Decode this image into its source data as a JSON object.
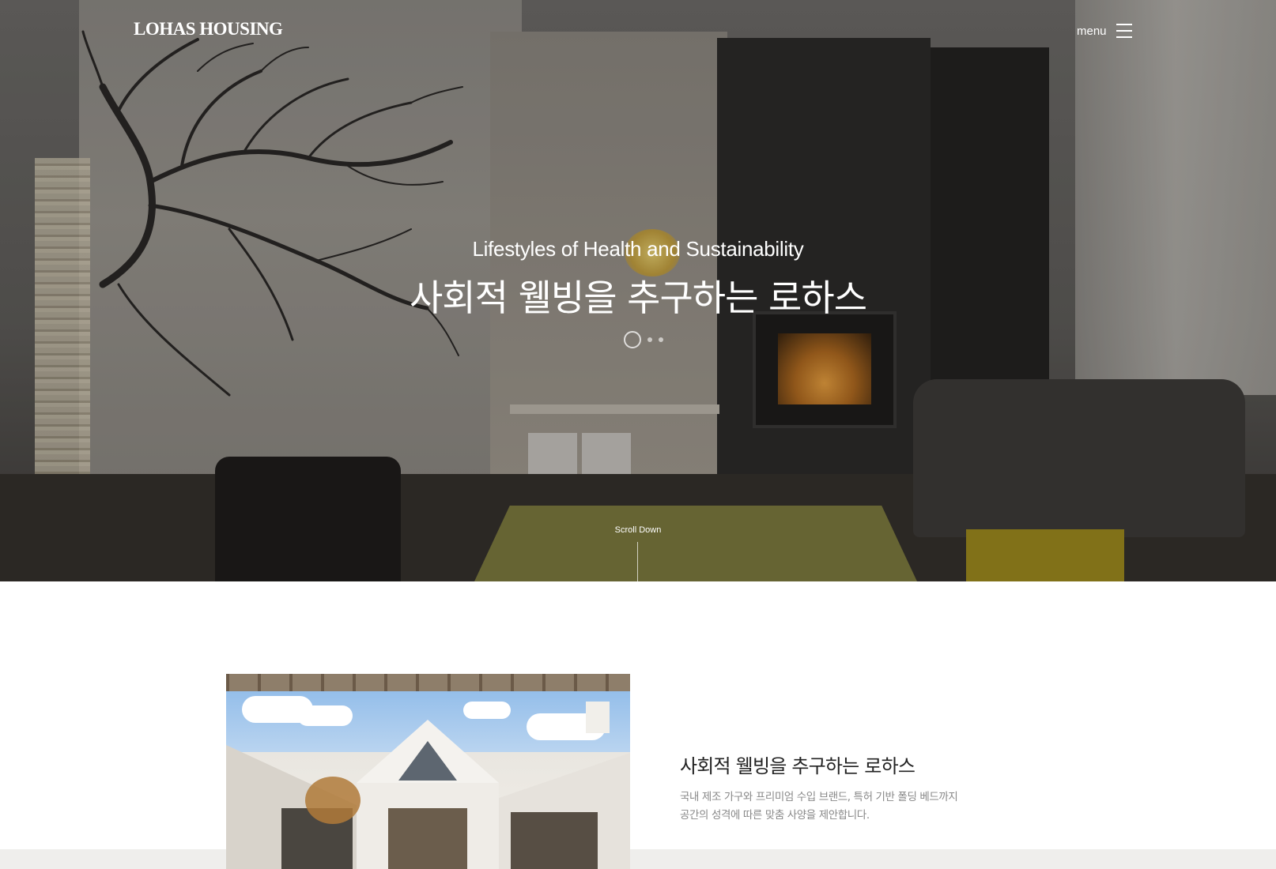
{
  "header": {
    "logo": "LOHAS HOUSING",
    "menu_label": "menu"
  },
  "hero": {
    "subtitle": "Lifestyles of Health and Sustainability",
    "title": "사회적 웰빙을 추구하는 로하스",
    "slides": {
      "count": 3,
      "active": 1
    },
    "scroll_label": "Scroll Down"
  },
  "intro": {
    "title": "사회적 웰빙을 추구하는 로하스",
    "desc_line1": "국내 제조 가구와 프리미엄 수입 브랜드, 특허 기반 폴딩 베드까지",
    "desc_line2": "공간의 성격에 따른 맞춤 사양을 제안합니다."
  },
  "icons": {
    "menu": "hamburger-icon"
  },
  "colors": {
    "hero_text": "#ffffff",
    "intro_title": "#222222",
    "intro_desc": "#888888",
    "band": "#efeeec"
  }
}
